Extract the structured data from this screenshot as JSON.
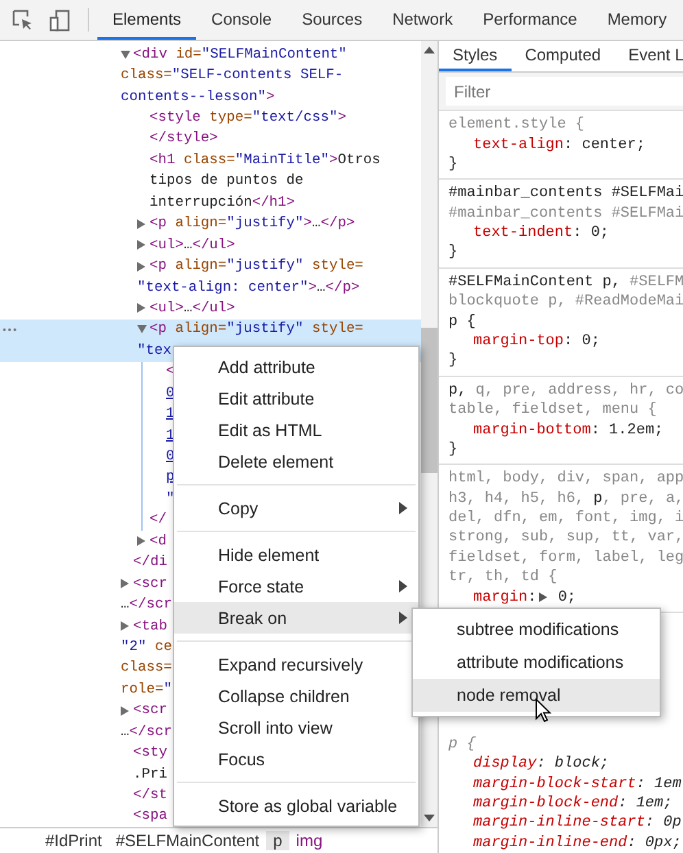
{
  "toolbar": {
    "tabs": [
      {
        "label": "Elements",
        "selected": true
      },
      {
        "label": "Console",
        "selected": false
      },
      {
        "label": "Sources",
        "selected": false
      },
      {
        "label": "Network",
        "selected": false
      },
      {
        "label": "Performance",
        "selected": false
      },
      {
        "label": "Memory",
        "selected": false
      }
    ]
  },
  "tree": {
    "nodes": [
      {
        "lines": [
          [
            {
              "text": "<div",
              "kind": "tag"
            },
            {
              "text": " id=",
              "kind": "attr"
            },
            {
              "text": "\"SELFMainContent\"",
              "kind": "value"
            }
          ],
          [
            {
              "text": "class=",
              "kind": "attr"
            },
            {
              "text": "\"SELF-contents SELF-",
              "kind": "value"
            }
          ],
          [
            {
              "text": "contents--lesson\"",
              "kind": "value"
            },
            {
              "text": ">",
              "kind": "tag"
            }
          ]
        ],
        "expandable": true,
        "expanded": true,
        "selected": false,
        "close": [
          {
            "text": "</di",
            "kind": "tag"
          }
        ],
        "children": [
          {
            "lines": [
              [
                {
                  "text": "<style",
                  "kind": "tag"
                },
                {
                  "text": " type=",
                  "kind": "attr"
                },
                {
                  "text": "\"text/css\"",
                  "kind": "value"
                },
                {
                  "text": ">",
                  "kind": "tag"
                }
              ]
            ],
            "expandable": false,
            "selected": false,
            "close": [
              {
                "text": "</style>",
                "kind": "tag"
              }
            ]
          },
          {
            "lines": [
              [
                {
                  "text": "<h1",
                  "kind": "tag"
                },
                {
                  "text": " class=",
                  "kind": "attr"
                },
                {
                  "text": "\"MainTitle\"",
                  "kind": "value"
                },
                {
                  "text": ">",
                  "kind": "tag"
                },
                {
                  "text": "Otros",
                  "kind": "text"
                }
              ],
              [
                {
                  "text": "tipos de puntos de",
                  "kind": "text"
                }
              ],
              [
                {
                  "text": "interrupción",
                  "kind": "text"
                },
                {
                  "text": "</h1>",
                  "kind": "tag"
                }
              ]
            ],
            "expandable": false,
            "selected": false
          },
          {
            "lines": [
              [
                {
                  "text": "<p",
                  "kind": "tag"
                },
                {
                  "text": " align=",
                  "kind": "attr"
                },
                {
                  "text": "\"justify\"",
                  "kind": "value"
                },
                {
                  "text": ">",
                  "kind": "tag"
                },
                {
                  "text": "…",
                  "kind": "text"
                },
                {
                  "text": "</p>",
                  "kind": "tag"
                }
              ]
            ],
            "expandable": true,
            "expanded": false,
            "selected": false
          },
          {
            "lines": [
              [
                {
                  "text": "<ul>",
                  "kind": "tag"
                },
                {
                  "text": "…",
                  "kind": "text"
                },
                {
                  "text": "</ul>",
                  "kind": "tag"
                }
              ]
            ],
            "expandable": true,
            "expanded": false,
            "selected": false
          },
          {
            "lines": [
              [
                {
                  "text": "<p",
                  "kind": "tag"
                },
                {
                  "text": " align=",
                  "kind": "attr"
                },
                {
                  "text": "\"justify\"",
                  "kind": "value"
                },
                {
                  "text": " style=",
                  "kind": "attr"
                }
              ],
              [
                {
                  "text": "\"text-align: center\"",
                  "kind": "value"
                },
                {
                  "text": ">",
                  "kind": "tag"
                },
                {
                  "text": "…",
                  "kind": "text"
                },
                {
                  "text": "</p>",
                  "kind": "tag"
                }
              ]
            ],
            "expandable": true,
            "expanded": false,
            "selected": false
          },
          {
            "lines": [
              [
                {
                  "text": "<ul>",
                  "kind": "tag"
                },
                {
                  "text": "…",
                  "kind": "text"
                },
                {
                  "text": "</ul>",
                  "kind": "tag"
                }
              ]
            ],
            "expandable": true,
            "expanded": false,
            "selected": false
          },
          {
            "lines": [
              [
                {
                  "text": "<p",
                  "kind": "tag"
                },
                {
                  "text": " align=",
                  "kind": "attr"
                },
                {
                  "text": "\"justify\"",
                  "kind": "value"
                },
                {
                  "text": " style=",
                  "kind": "attr"
                }
              ],
              [
                {
                  "text": "\"tex",
                  "kind": "value"
                }
              ]
            ],
            "expandable": true,
            "expanded": true,
            "selected": true,
            "close": [
              {
                "text": "</",
                "kind": "tag"
              }
            ],
            "children": [
              {
                "lines": [
                  [
                    {
                      "text": "<",
                      "kind": "tag"
                    }
                  ],
                  [
                    {
                      "text": "0",
                      "kind": "link"
                    }
                  ],
                  [
                    {
                      "text": "1",
                      "kind": "link"
                    }
                  ],
                  [
                    {
                      "text": "1",
                      "kind": "link"
                    }
                  ],
                  [
                    {
                      "text": "0",
                      "kind": "link"
                    }
                  ],
                  [
                    {
                      "text": "p",
                      "kind": "link"
                    }
                  ],
                  [
                    {
                      "text": "\"",
                      "kind": "value"
                    }
                  ]
                ],
                "expandable": false,
                "selected": false
              }
            ]
          },
          {
            "lines": [
              [
                {
                  "text": "<d",
                  "kind": "tag"
                }
              ]
            ],
            "expandable": true,
            "expanded": false,
            "selected": false
          }
        ]
      },
      {
        "lines": [
          [
            {
              "text": "<scr",
              "kind": "tag"
            }
          ],
          [
            {
              "text": "…",
              "kind": "text"
            },
            {
              "text": "</scr",
              "kind": "tag"
            }
          ]
        ],
        "expandable": true,
        "expanded": false,
        "selected": false
      },
      {
        "lines": [
          [
            {
              "text": "<tab",
              "kind": "tag"
            }
          ],
          [
            {
              "text": "\"2\"",
              "kind": "value"
            },
            {
              "text": " ce",
              "kind": "attr"
            }
          ],
          [
            {
              "text": "class=",
              "kind": "attr"
            }
          ],
          [
            {
              "text": "role=",
              "kind": "attr"
            },
            {
              "text": "\"",
              "kind": "value"
            }
          ]
        ],
        "expandable": true,
        "expanded": false,
        "selected": false
      },
      {
        "lines": [
          [
            {
              "text": "<scr",
              "kind": "tag"
            }
          ],
          [
            {
              "text": "…",
              "kind": "text"
            },
            {
              "text": "</scr",
              "kind": "tag"
            }
          ]
        ],
        "expandable": true,
        "expanded": false,
        "selected": false
      },
      {
        "lines": [
          [
            {
              "text": "<sty",
              "kind": "tag"
            }
          ],
          [
            {
              "text": ".Pri",
              "kind": "text"
            }
          ]
        ],
        "expandable": false,
        "selected": false,
        "close": [
          {
            "text": "</st",
            "kind": "tag"
          }
        ]
      },
      {
        "lines": [
          [
            {
              "text": "<spa",
              "kind": "tag"
            }
          ]
        ],
        "expandable": false,
        "selected": false
      }
    ]
  },
  "breadcrumbs": [
    {
      "label": "#IdPrint",
      "selected": false,
      "hovered": false
    },
    {
      "label": "#SELFMainContent",
      "selected": false,
      "hovered": false
    },
    {
      "label": "p",
      "selected": true,
      "hovered": false
    },
    {
      "label": "img",
      "selected": false,
      "hovered": true
    }
  ],
  "context_menu": {
    "groups": [
      [
        {
          "label": "Add attribute",
          "has_submenu": false,
          "highlighted": false
        },
        {
          "label": "Edit attribute",
          "has_submenu": false,
          "highlighted": false
        },
        {
          "label": "Edit as HTML",
          "has_submenu": false,
          "highlighted": false
        },
        {
          "label": "Delete element",
          "has_submenu": false,
          "highlighted": false
        }
      ],
      [
        {
          "label": "Copy",
          "has_submenu": true,
          "highlighted": false
        }
      ],
      [
        {
          "label": "Hide element",
          "has_submenu": false,
          "highlighted": false
        },
        {
          "label": "Force state",
          "has_submenu": true,
          "highlighted": false
        },
        {
          "label": "Break on",
          "has_submenu": true,
          "highlighted": true
        }
      ],
      [
        {
          "label": "Expand recursively",
          "has_submenu": false,
          "highlighted": false
        },
        {
          "label": "Collapse children",
          "has_submenu": false,
          "highlighted": false
        },
        {
          "label": "Scroll into view",
          "has_submenu": false,
          "highlighted": false
        },
        {
          "label": "Focus",
          "has_submenu": false,
          "highlighted": false
        }
      ],
      [
        {
          "label": "Store as global variable",
          "has_submenu": false,
          "highlighted": false
        }
      ]
    ],
    "submenu": [
      {
        "label": "subtree modifications",
        "highlighted": false
      },
      {
        "label": "attribute modifications",
        "highlighted": false
      },
      {
        "label": "node removal",
        "highlighted": true
      }
    ]
  },
  "styles_pane": {
    "tabs": [
      {
        "label": "Styles",
        "selected": true
      },
      {
        "label": "Computed",
        "selected": false
      },
      {
        "label": "Event L",
        "selected": false
      }
    ],
    "filter": {
      "placeholder": "Filter"
    },
    "rules": [
      {
        "kind": "author",
        "selector_lines": [
          [
            {
              "text": "element.style {",
              "matched": false
            }
          ]
        ],
        "declarations": [
          {
            "text": "text-align: center;",
            "expandable": false
          }
        ],
        "close": "}"
      },
      {
        "kind": "author",
        "selector_lines": [
          [
            {
              "text": "#mainbar_contents #SELFMai",
              "matched": true
            }
          ],
          [
            {
              "text": "#mainbar_contents #SELFMai",
              "matched": false
            }
          ]
        ],
        "declarations": [
          {
            "text": "text-indent: 0;",
            "expandable": false
          }
        ],
        "close": "}"
      },
      {
        "kind": "author",
        "selector_lines": [
          [
            {
              "text": "#SELFMainContent p,",
              "matched": true
            },
            {
              "text": " #SELFM",
              "matched": false
            }
          ],
          [
            {
              "text": "blockquote p, #ReadModeMai",
              "matched": false
            }
          ],
          [
            {
              "text": "p {",
              "matched": true
            }
          ]
        ],
        "declarations": [
          {
            "text": "margin-top: 0;",
            "expandable": false
          }
        ],
        "close": "}"
      },
      {
        "kind": "author",
        "selector_lines": [
          [
            {
              "text": "p,",
              "matched": true
            },
            {
              "text": " q, pre, address, hr, co",
              "matched": false
            }
          ],
          [
            {
              "text": "table, fieldset, menu {",
              "matched": false
            }
          ]
        ],
        "declarations": [
          {
            "text": "margin-bottom: 1.2em;",
            "expandable": false
          }
        ],
        "close": "}"
      },
      {
        "kind": "author",
        "selector_lines": [
          [
            {
              "text": "html, body, div, span, app",
              "matched": false
            }
          ],
          [
            {
              "text": "h3, h4, h5, h6, ",
              "matched": false
            },
            {
              "text": "p",
              "matched": true
            },
            {
              "text": ", pre, a,",
              "matched": false
            }
          ],
          [
            {
              "text": "del, dfn, em, font, img, i",
              "matched": false
            }
          ],
          [
            {
              "text": "strong, sub, sup, tt, var,",
              "matched": false
            }
          ],
          [
            {
              "text": "fieldset, form, label, leg",
              "matched": false
            }
          ],
          [
            {
              "text": "tr, th, td {",
              "matched": false
            }
          ]
        ],
        "declarations": [
          {
            "text": "margin: 0;",
            "expandable": true
          }
        ]
      },
      {
        "kind": "user-agent",
        "selector_lines": [
          [
            {
              "text": "p {",
              "matched": false
            }
          ]
        ],
        "declarations": [
          {
            "text": "display: block;",
            "expandable": false
          },
          {
            "text": "margin-block-start: 1em",
            "expandable": false
          },
          {
            "text": "margin-block-end: 1em;",
            "expandable": false
          },
          {
            "text": "margin-inline-start: 0p",
            "expandable": false
          },
          {
            "text": "margin-inline-end: 0px;",
            "expandable": false
          }
        ]
      }
    ]
  }
}
